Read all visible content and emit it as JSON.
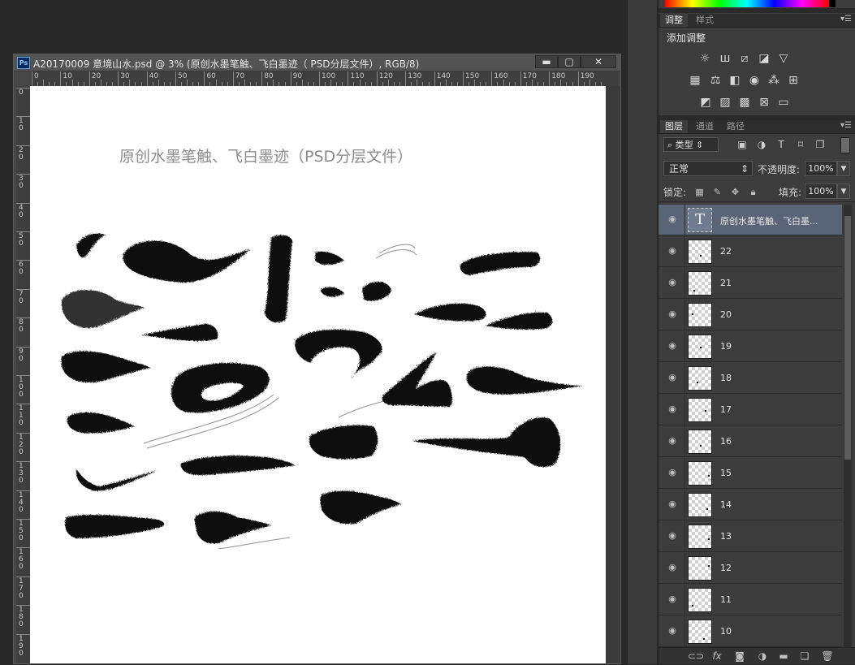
{
  "document": {
    "title": "A20170009 意境山水.psd @ 3% (原创水墨笔触、飞白墨迹（ PSD分层文件）, RGB/8)",
    "controls": {
      "minimize": "▬",
      "restore": "▢",
      "close": "✕"
    },
    "ruler_top": [
      "0",
      "10",
      "20",
      "30",
      "40",
      "50",
      "60",
      "70",
      "80",
      "90",
      "100",
      "110",
      "120",
      "130",
      "140",
      "150",
      "160",
      "170",
      "180",
      "190"
    ],
    "ruler_left": [
      "0",
      "1 0",
      "2 0",
      "3 0",
      "4 0",
      "5 0",
      "6 0",
      "7 0",
      "8 0",
      "9 0",
      "1 0 0",
      "1 1 0",
      "1 2 0",
      "1 3 0",
      "1 4 0",
      "1 5 0",
      "1 6 0",
      "1 7 0",
      "1 8 0",
      "1 9 0"
    ],
    "canvas_text": "原创水墨笔触、飞白墨迹（PSD分层文件）"
  },
  "adjustments": {
    "tabs": [
      "调整",
      "样式"
    ],
    "heading": "添加调整",
    "icons": [
      "brightness-icon",
      "levels-icon",
      "curves-icon",
      "exposure-icon",
      "vibrance-icon",
      "hue-saturation-icon",
      "color-balance-icon",
      "black-white-icon",
      "photo-filter-icon",
      "channel-mixer-icon",
      "color-lookup-icon",
      "invert-icon",
      "posterize-icon",
      "threshold-icon",
      "selective-color-icon",
      "gradient-map-icon"
    ]
  },
  "layers_panel": {
    "tabs": [
      "图层",
      "通道",
      "路径"
    ],
    "filter_label": "类型",
    "blend_mode": "正常",
    "opacity_label": "不透明度:",
    "opacity_value": "100%",
    "lock_label": "锁定:",
    "fill_label": "填充:",
    "fill_value": "100%",
    "layers": [
      {
        "name": "原创水墨笔触、飞白墨...",
        "type": "text",
        "selected": true
      },
      {
        "name": "22",
        "type": "pixel",
        "selected": false
      },
      {
        "name": "21",
        "type": "pixel",
        "selected": false
      },
      {
        "name": "20",
        "type": "pixel",
        "selected": false
      },
      {
        "name": "19",
        "type": "pixel",
        "selected": false
      },
      {
        "name": "18",
        "type": "pixel",
        "selected": false
      },
      {
        "name": "17",
        "type": "pixel",
        "selected": false
      },
      {
        "name": "16",
        "type": "pixel",
        "selected": false
      },
      {
        "name": "15",
        "type": "pixel",
        "selected": false
      },
      {
        "name": "14",
        "type": "pixel",
        "selected": false
      },
      {
        "name": "13",
        "type": "pixel",
        "selected": false
      },
      {
        "name": "12",
        "type": "pixel",
        "selected": false
      },
      {
        "name": "11",
        "type": "pixel",
        "selected": false
      },
      {
        "name": "10",
        "type": "pixel",
        "selected": false
      }
    ],
    "text_thumb_glyph": "T",
    "bottom_icons": [
      "link-icon",
      "fx-icon",
      "mask-icon",
      "adjustment-layer-icon",
      "group-folder-icon",
      "new-layer-icon",
      "trash-icon"
    ]
  }
}
